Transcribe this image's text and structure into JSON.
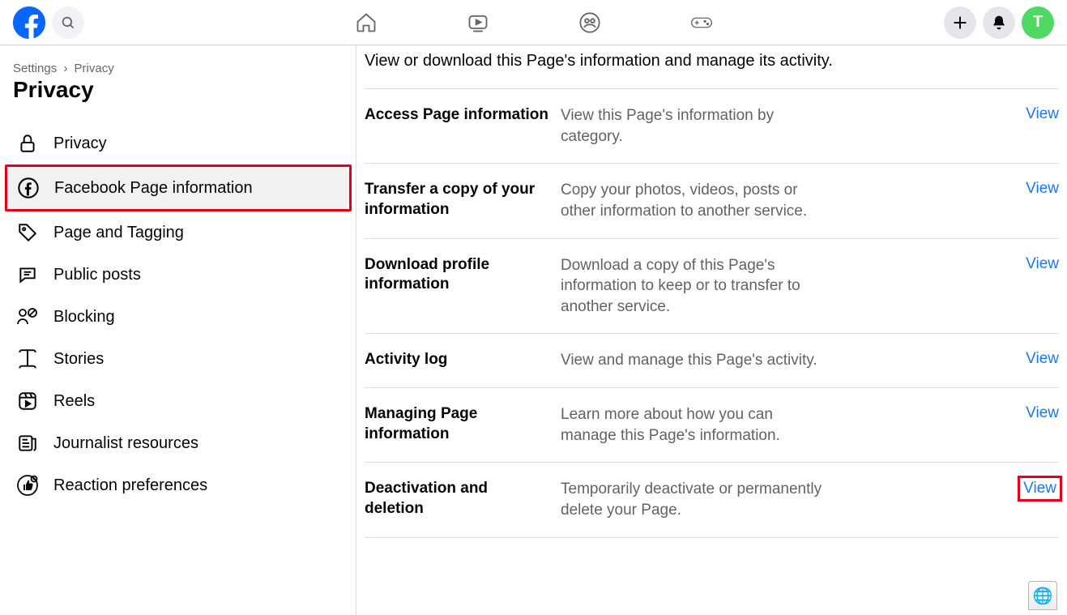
{
  "header": {
    "avatar_initial": "T"
  },
  "breadcrumb": {
    "settings": "Settings",
    "sep": "›",
    "privacy": "Privacy"
  },
  "page_title": "Privacy",
  "sidebar": {
    "items": [
      {
        "label": "Privacy"
      },
      {
        "label": "Facebook Page information"
      },
      {
        "label": "Page and Tagging"
      },
      {
        "label": "Public posts"
      },
      {
        "label": "Blocking"
      },
      {
        "label": "Stories"
      },
      {
        "label": "Reels"
      },
      {
        "label": "Journalist resources"
      },
      {
        "label": "Reaction preferences"
      }
    ]
  },
  "main": {
    "intro": "View or download this Page's information and manage its activity.",
    "rows": [
      {
        "title": "Access Page information",
        "desc": "View this Page's information by category.",
        "action": "View"
      },
      {
        "title": "Transfer a copy of your information",
        "desc": "Copy your photos, videos, posts or other information to another service.",
        "action": "View"
      },
      {
        "title": "Download profile information",
        "desc": "Download a copy of this Page's information to keep or to transfer to another service.",
        "action": "View"
      },
      {
        "title": "Activity log",
        "desc": "View and manage this Page's activity.",
        "action": "View"
      },
      {
        "title": "Managing Page information",
        "desc": "Learn more about how you can manage this Page's information.",
        "action": "View"
      },
      {
        "title": "Deactivation and deletion",
        "desc": "Temporarily deactivate or permanently delete your Page.",
        "action": "View"
      }
    ]
  }
}
